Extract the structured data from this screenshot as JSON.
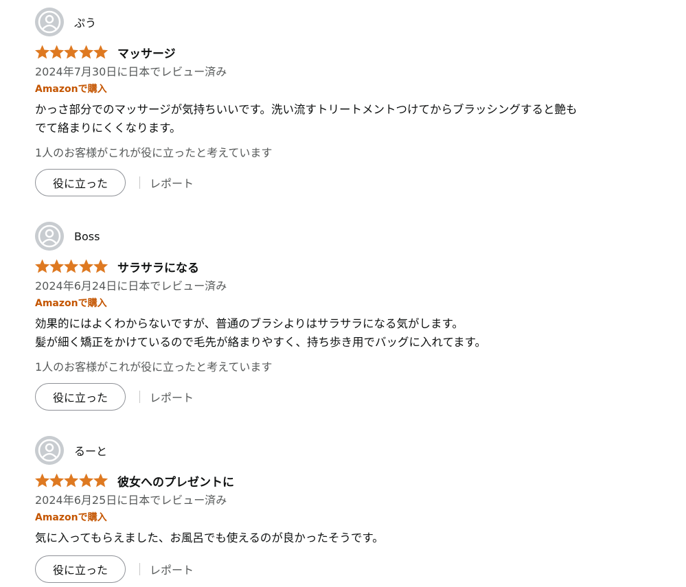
{
  "colors": {
    "star": "#de7921",
    "verified": "#c45500",
    "meta": "#565959"
  },
  "reviews": [
    {
      "user": "ぷう",
      "rating": 5,
      "title": "マッサージ",
      "date": "2024年7月30日に日本でレビュー済み",
      "verified": "Amazonで購入",
      "body": [
        "かっさ部分でのマッサージが気持ちいいです。洗い流すトリートメントつけてからブラッシングすると艶も",
        "でて絡まりにくくなります。"
      ],
      "helpful_count": "1人のお客様がこれが役に立ったと考えています",
      "helpful_button": "役に立った",
      "report": "レポート"
    },
    {
      "user": "Boss",
      "rating": 5,
      "title": "サラサラになる",
      "date": "2024年6月24日に日本でレビュー済み",
      "verified": "Amazonで購入",
      "body": [
        "効果的にはよくわからないですが、普通のブラシよりはサラサラになる気がします。",
        "髪が細く矯正をかけているので毛先が絡まりやすく、持ち歩き用でバッグに入れてます。"
      ],
      "helpful_count": "1人のお客様がこれが役に立ったと考えています",
      "helpful_button": "役に立った",
      "report": "レポート"
    },
    {
      "user": "るーと",
      "rating": 5,
      "title": "彼女へのプレゼントに",
      "date": "2024年6月25日に日本でレビュー済み",
      "verified": "Amazonで購入",
      "body": [
        "気に入ってもらえました、お風呂でも使えるのが良かったそうです。"
      ],
      "helpful_button": "役に立った",
      "report": "レポート"
    }
  ]
}
